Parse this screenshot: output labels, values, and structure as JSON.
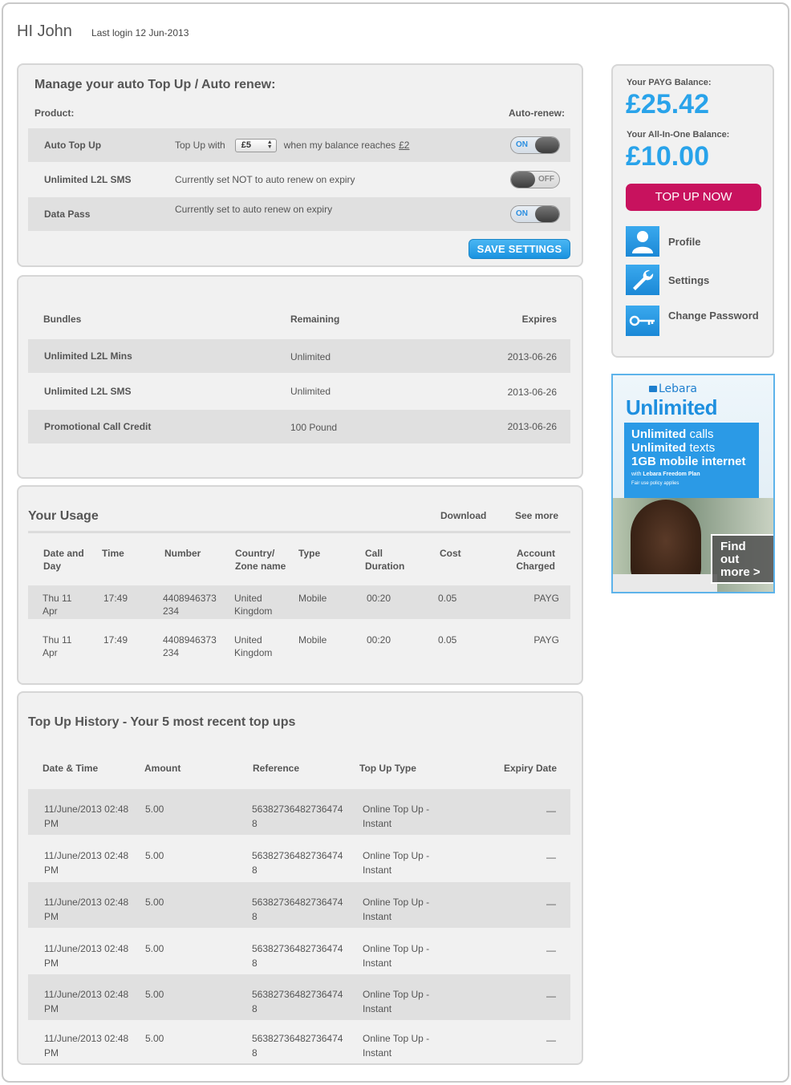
{
  "greeting": {
    "hi": "HI John",
    "last_login": "Last login 12 Jun-2013"
  },
  "auto_topup": {
    "title": "Manage your auto Top Up / Auto renew:",
    "col_product": "Product:",
    "col_auto_renew": "Auto-renew:",
    "rows": [
      {
        "product": "Auto Top Up",
        "desc_pre": "Top Up with",
        "select_value": "£5",
        "desc_post": "when my balance reaches",
        "threshold": "£2",
        "toggle": "ON"
      },
      {
        "product": "Unlimited L2L SMS",
        "desc": "Currently set NOT to auto renew on expiry",
        "toggle": "OFF"
      },
      {
        "product": "Data Pass",
        "desc": "Currently set to auto renew on expiry",
        "toggle": "ON"
      }
    ],
    "save_label": "SAVE SETTINGS"
  },
  "bundles": {
    "headers": [
      "Bundles",
      "Remaining",
      "Expires"
    ],
    "rows": [
      [
        "Unlimited L2L Mins",
        "Unlimited",
        "2013-06-26"
      ],
      [
        "Unlimited L2L SMS",
        "Unlimited",
        "2013-06-26"
      ],
      [
        "Promotional Call Credit",
        "100 Pound",
        "2013-06-26"
      ]
    ]
  },
  "usage": {
    "title": "Your Usage",
    "download": "Download",
    "see_more": "See more",
    "headers": {
      "date": [
        "Date and",
        "Day"
      ],
      "time": "Time",
      "number": "Number",
      "country": [
        "Country/",
        "Zone name"
      ],
      "type": "Type",
      "duration": [
        "Call",
        "Duration"
      ],
      "cost": "Cost",
      "account": [
        "Account",
        "Charged"
      ]
    },
    "rows": [
      {
        "date": [
          "Thu 11",
          "Apr"
        ],
        "time": "17:49",
        "number": [
          "4408946373",
          "234"
        ],
        "country": [
          "United",
          "Kingdom"
        ],
        "type": "Mobile",
        "duration": "00:20",
        "cost": "0.05",
        "account": "PAYG"
      },
      {
        "date": [
          "Thu 11",
          "Apr"
        ],
        "time": "17:49",
        "number": [
          "4408946373",
          "234"
        ],
        "country": [
          "United",
          "Kingdom"
        ],
        "type": "Mobile",
        "duration": "00:20",
        "cost": "0.05",
        "account": "PAYG"
      }
    ]
  },
  "history": {
    "title": "Top Up History - Your 5 most recent top ups",
    "headers": [
      "Date & Time",
      "Amount",
      "Reference",
      "Top Up Type",
      "Expiry Date"
    ],
    "rows": [
      {
        "date": [
          "11/June/2013 02:48",
          "PM"
        ],
        "amount": "5.00",
        "ref": [
          "56382736482736474",
          "8"
        ],
        "type": [
          "Online Top Up -",
          "Instant"
        ],
        "expiry": "—"
      },
      {
        "date": [
          "11/June/2013 02:48",
          "PM"
        ],
        "amount": "5.00",
        "ref": [
          "56382736482736474",
          "8"
        ],
        "type": [
          "Online Top Up -",
          "Instant"
        ],
        "expiry": "—"
      },
      {
        "date": [
          "11/June/2013 02:48",
          "PM"
        ],
        "amount": "5.00",
        "ref": [
          "56382736482736474",
          "8"
        ],
        "type": [
          "Online Top Up -",
          "Instant"
        ],
        "expiry": "—"
      },
      {
        "date": [
          "11/June/2013 02:48",
          "PM"
        ],
        "amount": "5.00",
        "ref": [
          "56382736482736474",
          "8"
        ],
        "type": [
          "Online Top Up -",
          "Instant"
        ],
        "expiry": "—"
      },
      {
        "date": [
          "11/June/2013 02:48",
          "PM"
        ],
        "amount": "5.00",
        "ref": [
          "56382736482736474",
          "8"
        ],
        "type": [
          "Online Top Up -",
          "Instant"
        ],
        "expiry": "—"
      },
      {
        "date": [
          "11/June/2013 02:48",
          "PM"
        ],
        "amount": "5.00",
        "ref": [
          "56382736482736474",
          "8"
        ],
        "type": [
          "Online Top Up -",
          "Instant"
        ],
        "expiry": "—"
      }
    ]
  },
  "sidebar": {
    "payg_label": "Your PAYG Balance:",
    "payg_amount": "£25.42",
    "aio_label": "Your All-In-One Balance:",
    "aio_amount": "£10.00",
    "topup_label": "TOP UP NOW",
    "items": [
      {
        "label": "Profile",
        "icon": "user-icon"
      },
      {
        "label": "Settings",
        "icon": "wrench-icon"
      },
      {
        "label": "Change Password",
        "icon": "key-icon"
      }
    ]
  },
  "ad": {
    "brand": "Lebara",
    "headline": "Unlimited",
    "line1_bold": "Unlimited",
    "line1_rest": " calls",
    "line2_bold": "Unlimited",
    "line2_rest": " texts",
    "line3": "1GB mobile internet",
    "line4_pre": "with ",
    "line4_bold": "Lebara Freedom Plan",
    "line5": "Fair use policy applies",
    "cta": [
      "Find",
      "out",
      "more >"
    ]
  },
  "colors": {
    "accent_blue": "#29a3ea",
    "topup_magenta": "#c8125e",
    "panel_bg": "#f1f1f1"
  }
}
